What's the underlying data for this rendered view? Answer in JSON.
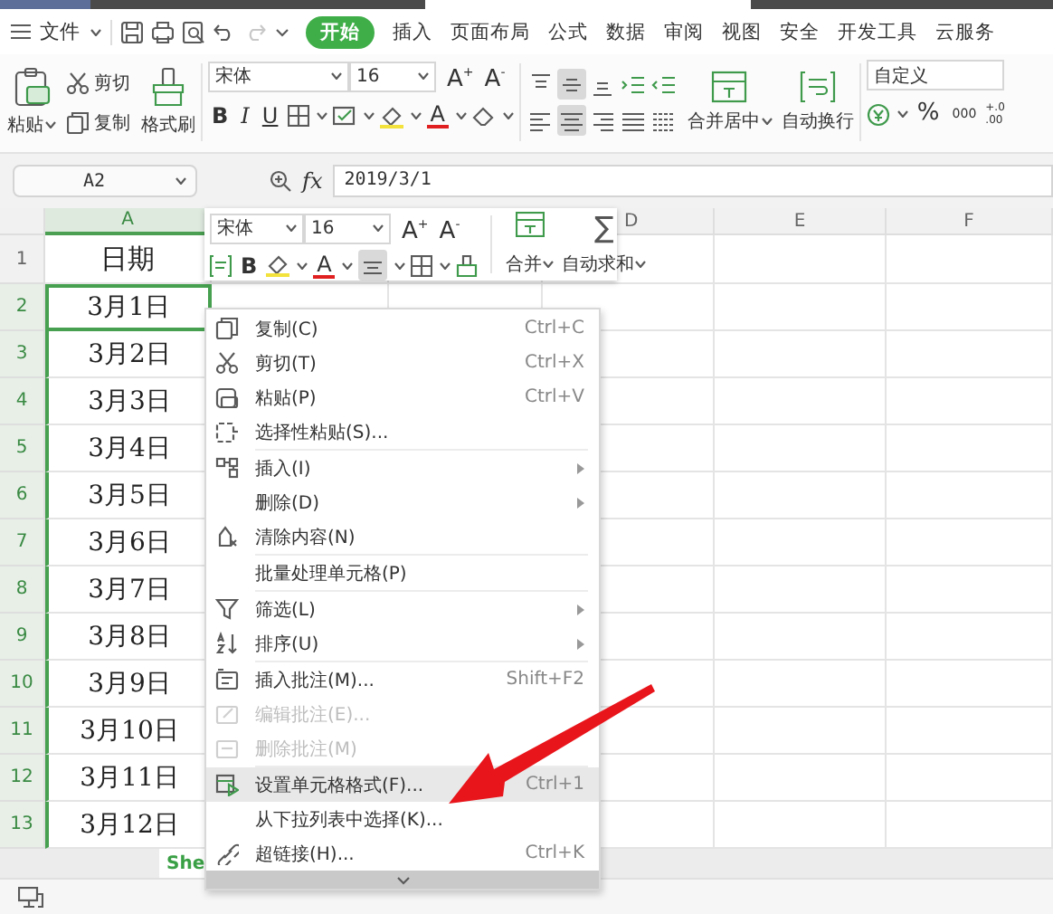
{
  "top_bar": {
    "file_menu": "文件",
    "tabs": [
      {
        "label": "开始",
        "selected": true
      },
      {
        "label": "插入",
        "selected": false
      },
      {
        "label": "页面布局",
        "selected": false
      },
      {
        "label": "公式",
        "selected": false
      },
      {
        "label": "数据",
        "selected": false
      },
      {
        "label": "审阅",
        "selected": false
      },
      {
        "label": "视图",
        "selected": false
      },
      {
        "label": "安全",
        "selected": false
      },
      {
        "label": "开发工具",
        "selected": false
      },
      {
        "label": "云服务",
        "selected": false
      }
    ]
  },
  "ribbon": {
    "clipboard": {
      "paste": "粘贴",
      "cut": "剪切",
      "copy": "复制",
      "format_painter": "格式刷"
    },
    "font": {
      "name": "宋体",
      "size": "16",
      "grow": "A$^{+}$",
      "shrink": "A$^{-}$",
      "bold": "B",
      "italic": "I",
      "underline": "U",
      "font_color": "A"
    },
    "alignment": {
      "buttons": [
        {
          "kind": "top",
          "selected": false
        },
        {
          "kind": "middle",
          "selected": true
        },
        {
          "kind": "bottom",
          "selected": false
        },
        {
          "kind": "outdent",
          "selected": false
        },
        {
          "kind": "indent",
          "selected": false
        },
        {
          "kind": "left",
          "selected": false
        },
        {
          "kind": "center",
          "selected": true
        },
        {
          "kind": "right",
          "selected": false
        },
        {
          "kind": "justify",
          "selected": false
        },
        {
          "kind": "distribute",
          "selected": false
        }
      ],
      "merge_center": "合并居中",
      "wrap_text": "自动换行"
    },
    "number": {
      "format": "自定义",
      "percent": "%",
      "thousands": "000",
      "decimal_top": "+.0",
      "decimal_bottom": ".00"
    }
  },
  "formula_bar": {
    "name_box": "A2",
    "fx": "fx",
    "value": "2019/3/1"
  },
  "sheet": {
    "columns": [
      {
        "label": "A",
        "selected": true
      },
      {
        "label": "D",
        "selected": false
      },
      {
        "label": "E",
        "selected": false
      },
      {
        "label": "F",
        "selected": false
      }
    ],
    "rows": [
      {
        "number": "1",
        "cell": "日期",
        "selected": false,
        "active": false
      },
      {
        "number": "2",
        "cell": "3月1日",
        "selected": true,
        "active": true
      },
      {
        "number": "3",
        "cell": "3月2日",
        "selected": true,
        "active": false
      },
      {
        "number": "4",
        "cell": "3月3日",
        "selected": true,
        "active": false
      },
      {
        "number": "5",
        "cell": "3月4日",
        "selected": true,
        "active": false
      },
      {
        "number": "6",
        "cell": "3月5日",
        "selected": true,
        "active": false
      },
      {
        "number": "7",
        "cell": "3月6日",
        "selected": true,
        "active": false
      },
      {
        "number": "8",
        "cell": "3月7日",
        "selected": true,
        "active": false
      },
      {
        "number": "9",
        "cell": "3月8日",
        "selected": true,
        "active": false
      },
      {
        "number": "10",
        "cell": "3月9日",
        "selected": true,
        "active": false
      },
      {
        "number": "11",
        "cell": "3月10日",
        "selected": true,
        "active": false
      },
      {
        "number": "12",
        "cell": "3月11日",
        "selected": true,
        "active": false
      },
      {
        "number": "13",
        "cell": "3月12日",
        "selected": true,
        "active": false
      }
    ]
  },
  "mini_toolbar": {
    "font": "宋体",
    "size": "16",
    "grow": "A$^{+}$",
    "shrink": "A$^{-}$",
    "bold": "B",
    "font_color": "A",
    "align": {
      "selected": true
    },
    "merge": "合并",
    "autosum_symbol": "∑",
    "autosum": "自动求和"
  },
  "context_menu": {
    "groups": [
      [
        {
          "label": "复制(C)",
          "shortcut": "Ctrl+C",
          "submenu": false,
          "disabled": false,
          "selected": false
        },
        {
          "label": "剪切(T)",
          "shortcut": "Ctrl+X",
          "submenu": false,
          "disabled": false,
          "selected": false
        },
        {
          "label": "粘贴(P)",
          "shortcut": "Ctrl+V",
          "submenu": false,
          "disabled": false,
          "selected": false
        },
        {
          "label": "选择性粘贴(S)...",
          "submenu": false,
          "disabled": false,
          "selected": false
        }
      ],
      [
        {
          "label": "插入(I)",
          "submenu": true,
          "disabled": false,
          "selected": false
        },
        {
          "label": "删除(D)",
          "submenu": true,
          "disabled": false,
          "selected": false
        },
        {
          "label": "清除内容(N)",
          "submenu": false,
          "disabled": false,
          "selected": false
        }
      ],
      [
        {
          "label": "批量处理单元格(P)",
          "submenu": false,
          "disabled": false,
          "selected": false
        }
      ],
      [
        {
          "label": "筛选(L)",
          "submenu": true,
          "disabled": false,
          "selected": false
        },
        {
          "label": "排序(U)",
          "submenu": true,
          "disabled": false,
          "selected": false
        }
      ],
      [
        {
          "label": "插入批注(M)...",
          "shortcut": "Shift+F2",
          "submenu": false,
          "disabled": false,
          "selected": false
        },
        {
          "label": "编辑批注(E)...",
          "submenu": false,
          "disabled": true,
          "selected": false
        },
        {
          "label": "删除批注(M)",
          "submenu": false,
          "disabled": true,
          "selected": false
        }
      ],
      [
        {
          "label": "设置单元格格式(F)...",
          "shortcut": "Ctrl+1",
          "submenu": false,
          "disabled": false,
          "selected": true
        },
        {
          "label": "从下拉列表中选择(K)...",
          "submenu": false,
          "disabled": false,
          "selected": false
        },
        {
          "label": "超链接(H)...",
          "shortcut": "Ctrl+K",
          "submenu": false,
          "disabled": false,
          "selected": false
        }
      ]
    ]
  },
  "sheet_tabs": [
    {
      "label": "She",
      "selected": true
    }
  ]
}
